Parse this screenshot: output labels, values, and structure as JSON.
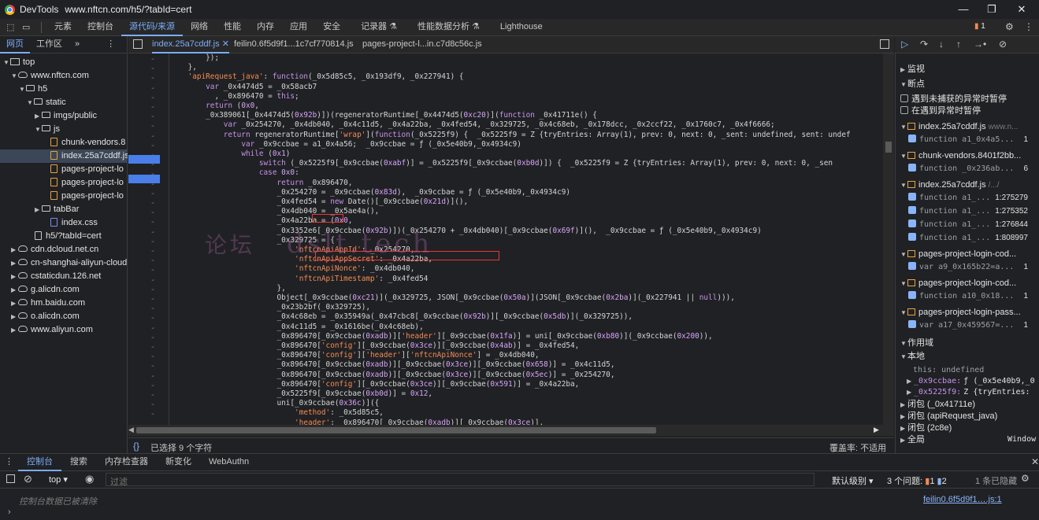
{
  "window": {
    "app": "DevTools",
    "url": "www.nftcn.com/h5/?tabId=cert"
  },
  "main_tabs": [
    "元素",
    "控制台",
    "源代码/来源",
    "网络",
    "性能",
    "内存",
    "应用",
    "安全",
    "记录器 ⚗",
    "性能数据分析 ⚗",
    "Lighthouse"
  ],
  "issues_badge": "1",
  "nav_tabs": [
    "网页",
    "工作区",
    "»"
  ],
  "tree": [
    {
      "label": "top",
      "type": "top",
      "open": true
    },
    {
      "label": "www.nftcn.com",
      "type": "cloud",
      "open": true
    },
    {
      "label": "h5",
      "type": "folder",
      "open": true
    },
    {
      "label": "static",
      "type": "folder",
      "open": true
    },
    {
      "label": "imgs/public",
      "type": "folder",
      "open": false
    },
    {
      "label": "js",
      "type": "folder",
      "open": true
    },
    {
      "label": "chunk-vendors.8",
      "type": "file"
    },
    {
      "label": "index.25a7cddf.js",
      "type": "file",
      "selected": true
    },
    {
      "label": "pages-project-lo",
      "type": "file"
    },
    {
      "label": "pages-project-lo",
      "type": "file"
    },
    {
      "label": "pages-project-lo",
      "type": "file"
    },
    {
      "label": "tabBar",
      "type": "folder",
      "open": false
    },
    {
      "label": "index.css",
      "type": "css"
    },
    {
      "label": "h5/?tabId=cert",
      "type": "doc"
    },
    {
      "label": "cdn.dcloud.net.cn",
      "type": "cloud",
      "open": false
    },
    {
      "label": "cn-shanghai-aliyun-cloud",
      "type": "cloud",
      "open": false
    },
    {
      "label": "cstaticdun.126.net",
      "type": "cloud",
      "open": false
    },
    {
      "label": "g.alicdn.com",
      "type": "cloud",
      "open": false
    },
    {
      "label": "hm.baidu.com",
      "type": "cloud",
      "open": false
    },
    {
      "label": "o.alicdn.com",
      "type": "cloud",
      "open": false
    },
    {
      "label": "www.aliyun.com",
      "type": "cloud",
      "open": false
    }
  ],
  "editor_tabs": [
    {
      "label": "index.25a7cddf.js",
      "active": true,
      "closable": true
    },
    {
      "label": "feilin0.6f5d9f1...1c7cf770814.js"
    },
    {
      "label": "pages-project-l...in.c7d8c56c.js"
    }
  ],
  "code_lines": [
    "        });",
    "    },",
    "    'apiRequest_java': function(_0x5d85c5, _0x193df9, _0x227941) {",
    "        var _0x4474d5 = _0x58acb7",
    "          , _0x896470 = this;",
    "        return (0x0,",
    "        _0x389061[_0x4474d5(0x92b)])(regeneratorRuntime[_0x4474d5(0xc20)](function _0x41711e() {",
    "            var _0x254270, _0x4db040, _0x4c11d5, _0x4a22ba, _0x4fed54, _0x329725, _0x4c68eb, _0x178dcc, _0x2ccf22, _0x1760c7, _0x4f6666;",
    "            return regeneratorRuntime['wrap'](function(_0x5225f9) {  _0x5225f9 = Z {tryEntries: Array(1), prev: 0, next: 0, _sent: undefined, sent: undef",
    "                var _0x9ccbae = a1_0x4a56;  _0x9ccbae = ƒ (_0x5e40b9,_0x4934c9)",
    "                while (0x1)",
    "                    switch (_0x5225f9[_0x9ccbae(0xabf)] = _0x5225f9[_0x9ccbae(0xb0d)]) {  _0x5225f9 = Z {tryEntries: Array(1), prev: 0, next: 0, _sen",
    "                    case 0x0:",
    "                        return _0x896470,",
    "                        _0x254270 = _0x9ccbae(0x83d),  _0x9ccbae = ƒ (_0x5e40b9,_0x4934c9)",
    "                        _0x4fed54 = new Date()[_0x9ccbae(0x21d)](),",
    "                        _0x4db040 = _0x5ae4a(),",
    "                        _0x4a22ba = (0x0,",
    "                        _0x3352e6[_0x9ccbae(0x92b)])(_0x254270 + _0x4db040)[_0x9ccbae(0x69f)](),  _0x9ccbae = ƒ (_0x5e40b9,_0x4934c9)",
    "                        _0x329725 = {",
    "                            'nftcnApiAppId': _0x254270,",
    "                            'nftcnApiAppSecret': _0x4a22ba,",
    "                            'nftcnApiNonce': _0x4db040,",
    "                            'nftcnApiTimestamp': _0x4fed54",
    "                        },",
    "                        Object[_0x9ccbae(0xc21)](_0x329725, JSON[_0x9ccbae(0x50a)](JSON[_0x9ccbae(0x2ba)](_0x227941 || null))),",
    "                        _0x23b2bf(_0x329725),",
    "                        _0x4c68eb = _0x35949a(_0x47cbc8[_0x9ccbae(0x92b)][_0x9ccbae(0x5db)](_0x329725)),",
    "                        _0x4c11d5 = _0x1616be(_0x4c68eb),",
    "                        _0x896470[_0x9ccbae(0xadb)]['header'][_0x9ccbae(0x1fa)] = uni[_0x9ccbae(0xb80)](_0x9ccbae(0x200)),",
    "                        _0x896470['config'][_0x9ccbae(0x3ce)][_0x9ccbae(0x4ab)] = _0x4fed54,",
    "                        _0x896470['config']['header']['nftcnApiNonce'] = _0x4db040,",
    "                        _0x896470[_0x9ccbae(0xadb)][_0x9ccbae(0x3ce)][_0x9ccbae(0x658)] = _0x4c11d5,",
    "                        _0x896470[_0x9ccbae(0xadb)][_0x9ccbae(0x3ce)][_0x9ccbae(0x5ec)] = _0x254270,",
    "                        _0x896470['config'][_0x9ccbae(0x3ce)][_0x9ccbae(0x591)] = _0x4a22ba,",
    "                        _0x5225f9[_0x9ccbae(0xb0d)] = 0x12,",
    "                        uni[_0x9ccbae(0x36c)]({",
    "                            'method': _0x5d85c5,",
    "                            'header': _0x896470[_0x9ccbae(0xadb)][_0x9ccbae(0x3ce)],"
  ],
  "watermark": "dslt.tech",
  "watermark_left": "论坛",
  "status": {
    "selected": "已选择 9 个字符",
    "coverage": "覆盖率: 不适用"
  },
  "right": {
    "sections": {
      "watch": "监视",
      "breakpoints": "断点",
      "scope": "作用域",
      "local": "本地"
    },
    "pause_uncaught": "遇到未捕获的异常时暂停",
    "pause_caught": "在遇到异常时暂停",
    "files": [
      {
        "name": "index.25a7cddf.js",
        "host": "www.n...",
        "bps": [
          {
            "code": "function a1_0x4a5...",
            "line": "1"
          }
        ]
      },
      {
        "name": "chunk-vendors.8401f2bb...",
        "host": "",
        "bps": [
          {
            "code": "function _0x236ab...",
            "line": "6"
          }
        ]
      },
      {
        "name": "index.25a7cddf.js",
        "host": "/.../",
        "bps": [
          {
            "code": "function a1_...",
            "line": "1:275279"
          },
          {
            "code": "function a1_...",
            "line": "1:275352"
          },
          {
            "code": "function a1_...",
            "line": "1:276844"
          },
          {
            "code": "function a1_...",
            "line": "1:808997"
          }
        ]
      },
      {
        "name": "pages-project-login-cod...",
        "host": "",
        "bps": [
          {
            "code": "var a9_0x165b22=a...",
            "line": "1"
          }
        ]
      },
      {
        "name": "pages-project-login-cod...",
        "host": "",
        "bps": [
          {
            "code": "function a10_0x18...",
            "line": "1"
          }
        ]
      },
      {
        "name": "pages-project-login-pass...",
        "host": "",
        "bps": [
          {
            "code": "var a17_0x459567=...",
            "line": "1"
          }
        ]
      }
    ],
    "scope_this": "this: undefined",
    "scope_vars": [
      {
        "name": "_0x9ccbae:",
        "value": "ƒ (_0x5e40b9,_0"
      },
      {
        "name": "_0x5225f9:",
        "value": "Z {tryEntries:"
      }
    ],
    "closures": [
      "闭包 (_0x41711e)",
      "闭包 (apiRequest_java)",
      "闭包 (2c8e)",
      "全局"
    ],
    "global_value": "Window"
  },
  "drawer": {
    "tabs": [
      "控制台",
      "搜索",
      "内存检查器",
      "新变化",
      "WebAuthn"
    ],
    "context": "top",
    "filter_placeholder": "过滤",
    "level": "默认级别",
    "issues_text": "3 个问题:",
    "issues_err": "1",
    "issues_info": "2",
    "hidden": "1 条已隐藏",
    "cleared": "控制台数据已被清除",
    "link": "feilin0.6f5d9f1….js:1"
  },
  "colors": {
    "accent": "#7cacf8",
    "highlight_box": "#e53935",
    "breakpoint": "#4a7ee8"
  }
}
